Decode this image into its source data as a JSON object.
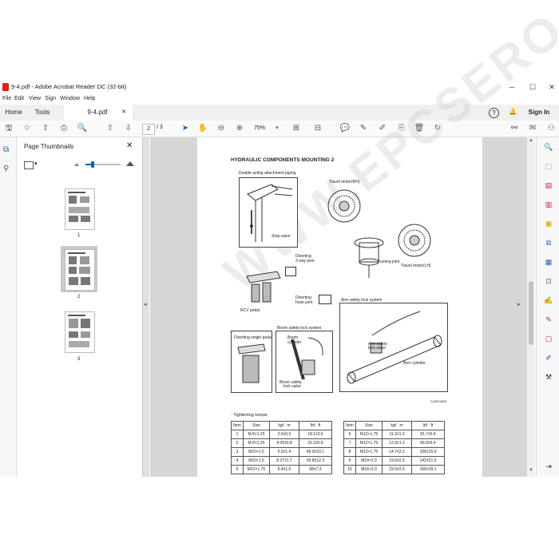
{
  "window": {
    "title": "9-4.pdf - Adobe Acrobat Reader DC (32-bit)",
    "min": "─",
    "max": "☐",
    "close": "✕"
  },
  "menu": [
    "File",
    "Edit",
    "View",
    "Sign",
    "Window",
    "Help"
  ],
  "tabs": {
    "home": "Home",
    "tools": "Tools",
    "doc": "9-4.pdf",
    "doc_close": "✕",
    "help": "?",
    "bell": "🔔",
    "signin": "Sign In"
  },
  "toolbar": {
    "page_current": "2",
    "page_total": "/ 3",
    "zoom": "75%"
  },
  "thumbnails": {
    "title": "Page Thumbnails",
    "close": "✕",
    "pages": [
      "1",
      "2",
      "3"
    ]
  },
  "doc": {
    "heading": "HYDRAULIC COMPONENTS MOUNTING 2",
    "labels": {
      "double_acting": "Double acting attachment piping",
      "stop_valve": "Stop valve",
      "travel_rh": "Travel motor(RH)",
      "travel_lh": "Travel motor(LH)",
      "turning": "Turning joint",
      "diverting3": "Diverting",
      "diverting3b": "3 way joint",
      "diverting_hose": "Diverting",
      "diverting_hose_b": "hose joint",
      "rcv_pedal": "RCV pedal",
      "arm_safety": "Arm safety lock system",
      "boom_safety": "Boom safety lock system",
      "diverting_single": "Diverting single pedal",
      "boom_cyl": "Boom",
      "boom_cyl_b": "cylinder",
      "boom_valve": "Boom safety",
      "boom_valve_b": "lock valve",
      "arm_valve": "Arm safety",
      "arm_valve_b": "lock valve",
      "arm_cyl": "Arm cylinder",
      "figcode": "210EC5MS"
    },
    "torque_title": "· Tightening torque",
    "torque_headers": [
      "Item",
      "Size",
      "kgf · m",
      "lbf · ft"
    ],
    "torque_left": [
      [
        "1",
        "M 8×1.25",
        "2.5±0.5",
        "18.1±3.6"
      ],
      [
        "2",
        "M 8×1.25",
        "4.05±0.8",
        "29.3±5.8"
      ],
      [
        "3",
        "M10×1.5",
        "6.9±1.4",
        "49.9±10.1"
      ],
      [
        "4",
        "M10×1.5",
        "8.27±1.7",
        "59.8±12.3"
      ],
      [
        "5",
        "M12×1.75",
        "9.4±1.0",
        "68±7.2"
      ]
    ],
    "torque_right": [
      [
        "6",
        "M12×1.75",
        "11.3±1.3",
        "81.7±9.4"
      ],
      [
        "7",
        "M12×1.75",
        "12.0±1.3",
        "86.8±9.4"
      ],
      [
        "8",
        "M12×1.75",
        "14.7±2.2",
        "106±15.9"
      ],
      [
        "9",
        "M14×2.0",
        "19.6±2.9",
        "142±21.0"
      ],
      [
        "10",
        "M16×2.0",
        "23.0±2.5",
        "166±18.1"
      ]
    ],
    "watermark": "WWW.EPCSERO.COM"
  }
}
